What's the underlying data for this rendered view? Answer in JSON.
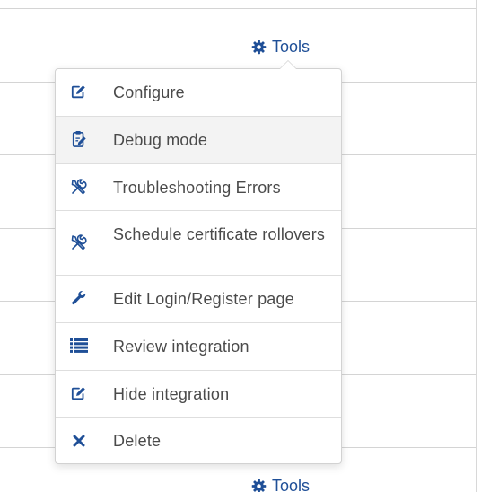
{
  "tools_label": "Tools",
  "menu": {
    "items": [
      {
        "label": "Configure",
        "icon": "edit-icon"
      },
      {
        "label": "Debug mode",
        "icon": "clipboard-edit-icon"
      },
      {
        "label": "Troubleshooting Errors",
        "icon": "tools-icon"
      },
      {
        "label": "Schedule certificate rollovers",
        "icon": "tools-icon"
      },
      {
        "label": "Edit Login/Register page",
        "icon": "wrench-icon"
      },
      {
        "label": "Review integration",
        "icon": "list-icon"
      },
      {
        "label": "Hide integration",
        "icon": "edit-icon"
      },
      {
        "label": "Delete",
        "icon": "close-icon"
      }
    ]
  },
  "colors": {
    "accent": "#1f4f97",
    "text": "#4a4a4a",
    "hover_background": "#f3f3f3"
  }
}
